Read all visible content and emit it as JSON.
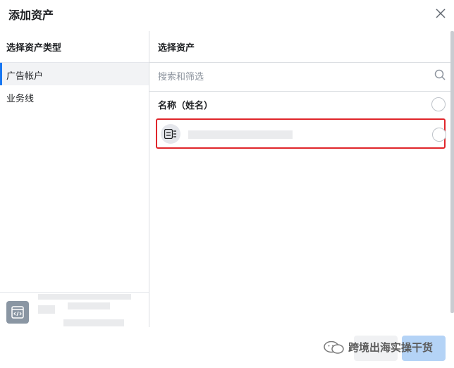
{
  "dialog": {
    "title": "添加资产",
    "close_icon": "close-icon"
  },
  "left_panel": {
    "title": "选择资产类型",
    "items": [
      {
        "label": "广告帐户",
        "active": true
      },
      {
        "label": "业务线",
        "active": false
      }
    ],
    "bottom_icon": "code-window-icon"
  },
  "right_panel": {
    "title": "选择资产",
    "search": {
      "placeholder": "搜索和筛选",
      "value": "",
      "icon": "search-icon"
    },
    "column_header": "名称（姓名）",
    "asset_icon": "page-list-icon"
  },
  "watermark": {
    "text": "跨境出海实操干货",
    "icon": "wechat-icon"
  },
  "colors": {
    "accent": "#1877f2",
    "highlight_border": "#e0262b",
    "primary_disabled": "#b4d3f6"
  }
}
